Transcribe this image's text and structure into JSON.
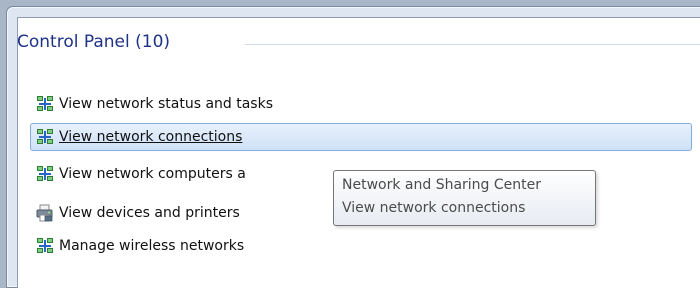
{
  "section": {
    "title": "Control Panel (10)"
  },
  "items": [
    {
      "label": "View network status and tasks",
      "icon": "network-icon"
    },
    {
      "label": "View network connections",
      "icon": "network-icon",
      "selected": true
    },
    {
      "label": "View network computers a",
      "icon": "network-icon"
    },
    {
      "label": "View devices and printers",
      "icon": "printer-icon"
    },
    {
      "label": "Manage wireless networks",
      "icon": "network-icon"
    }
  ],
  "tooltip": {
    "line1": "Network and Sharing Center",
    "line2": "View network connections"
  },
  "colors": {
    "title": "#1e3287",
    "selection_border": "#84acdd",
    "selection_bg": "#cfe1f8"
  }
}
